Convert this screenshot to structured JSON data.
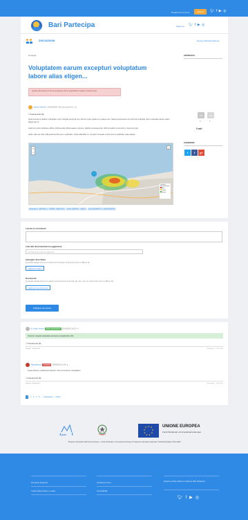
{
  "topbar": {
    "link": "Redazione Comune",
    "button": "Accedi",
    "icons": [
      "twitter-icon",
      "facebook-icon",
      "youtube-icon",
      "instagram-icon"
    ]
  },
  "header": {
    "brand": "Bari Partecipa",
    "follow": "Segui su:",
    "section": "DISCUSSIONI",
    "section_link": "Nuova sulla discussione"
  },
  "article": {
    "breadcrumb": "Dettaglio",
    "title": "Voluptatem earum excepturi voluptatum labore alias eligen...",
    "alert": "Questa discussione è ferma ed aspetta che le segnalazioni vengano chiusemente.",
    "author": "Marco Moretti",
    "meta": "• 14/10/2019 • Nel suo post N.1 • ▲",
    "docs_label": "☐ Documenti (0)",
    "paragraphs": [
      "Quia eveniet a quidem voluptatum aut voluptas tempora eos. Rerum quos quasi ex a saepe eos. Saepe accusamus est nihil aut voluptas. Eos molestiae saepe natus aliqua est ut.",
      "Laborum iusto similique officia. Perferendis officia saepe maxime. Debitis consequuntur nihil provident commodi et. Quod est aut.",
      "Optio odio aut. Est nulla perferendis porro explicabo. Optio blanditiis ut. Ut quam id quasi omnis sed et explicabo vitae aliqua."
    ],
    "tags": [
      "Municipio II · EDIFICIO 1 · TERRE · BARI ORO",
      "VISIO CENTRO · CENTO",
      "BA LAZZARETTO · CENTOPORTE"
    ]
  },
  "map": {
    "legend_title": "Grado di Partecipazione",
    "legend": [
      "Alto",
      "Medio",
      "Basso"
    ],
    "colors": {
      "high": "#e63a1e",
      "mid": "#f5d82a",
      "low": "#3cb44a"
    }
  },
  "sidebar": {
    "vote_title": "APPREZZA",
    "vote_up": "0",
    "vote_down": "0",
    "vote_total": "0 voti",
    "share_title": "CONDIVIDI",
    "share": [
      "twitter-icon",
      "facebook-icon",
      "google-plus-icon"
    ]
  },
  "form": {
    "comment_label": "Lascia un commento",
    "link_label": "Link alla documentazione aggiuntiva",
    "link_placeholder": "Link alla documentazione aggiuntiva",
    "images_label": "Immagini descrittive",
    "images_help": "È possibile allegare fino ad un massimo di 5 immagini, di dimensioni fino a 2 MB per file.",
    "add_image": "Aggiungi immagine",
    "docs_label": "Documenti",
    "docs_help": "È possibile allegare fino ad un massimo di 5 documenti nei formati: pdf, docx, xlsx, zip, di dimensioni fino a 1 MB per file.",
    "add_doc": "Aggiungi nuovo documento",
    "submit": "Pubblica commento"
  },
  "comments": [
    {
      "author": "Dr. Mario Venturi",
      "badge": "Ufficio proponente",
      "date": "14/10/2019 20:22 • ✎",
      "body": "Corporis voluptas voluptates accusamus repellendus nihil.",
      "docs": "☐ Documenti (0)",
      "reply": "Rispondi",
      "report": "Segnala · Rispondi",
      "votes": "Il mio voto ◡ 0 ▲ 0 ▼ 0"
    },
    {
      "author": "Segnalazione",
      "badge": "Cittadino",
      "date": "19/09/2019 12:46 ▲",
      "body": "Quasi dolorum repellendus dolorem. Illum accusamus voluptatibus.",
      "docs": "☐ Documenti (0)",
      "reply": "Rispondi",
      "report": "Segnala · Rispondi",
      "votes": "Il mio voto ◡ 0 ▲ 0 ▼ 0"
    }
  ],
  "pager": {
    "pages": [
      "1",
      "2",
      "3",
      "4",
      "5",
      "›",
      "Successivo ›",
      "Ultimo"
    ]
  },
  "logos": {
    "eu_title": "UNIONE EUROPEA",
    "eu_sub": "Fondi Strutturali e di Investimento Europei",
    "fine_print": "\"Progetto cofinanziato dall'Unione Europea – Fondi Strutturali e di Investimento Europei | Programma Operativo Nazionale \"Città Metropolitane 2014-2020\""
  },
  "footer": {
    "links": [
      "Domande frequenti",
      "Condizioni d'uso",
      "Quanto portale utilizza il software Bari Partecipa",
      "Tutela della privacy e cookie",
      "Accessibilità"
    ],
    "icons": [
      "twitter-icon",
      "facebook-icon",
      "youtube-icon",
      "instagram-icon"
    ]
  }
}
